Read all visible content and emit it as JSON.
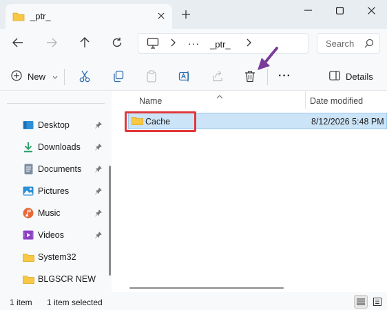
{
  "tab": {
    "title": "_ptr_"
  },
  "address": {
    "ellipsis": "···",
    "crumb": "_ptr_"
  },
  "search": {
    "placeholder": "Search"
  },
  "command_bar": {
    "new_label": "New",
    "more": "···",
    "details_label": "Details"
  },
  "sidebar": {
    "items": [
      {
        "label": "Desktop",
        "icon": "desktop-icon",
        "pinned": true
      },
      {
        "label": "Downloads",
        "icon": "download-icon",
        "pinned": true
      },
      {
        "label": "Documents",
        "icon": "document-icon",
        "pinned": true
      },
      {
        "label": "Pictures",
        "icon": "picture-icon",
        "pinned": true
      },
      {
        "label": "Music",
        "icon": "music-icon",
        "pinned": true
      },
      {
        "label": "Videos",
        "icon": "video-icon",
        "pinned": true
      },
      {
        "label": "System32",
        "icon": "folder-icon",
        "pinned": false
      },
      {
        "label": "BLGSCR NEW",
        "icon": "folder-icon",
        "pinned": false
      }
    ]
  },
  "file_list": {
    "columns": {
      "name": "Name",
      "date": "Date modified"
    },
    "rows": [
      {
        "name": "Cache",
        "date": "8/12/2026 5:48 PM",
        "selected": true
      }
    ]
  },
  "status": {
    "count": "1 item",
    "selection": "1 item selected"
  },
  "colors": {
    "accent": "#0067c0",
    "selection": "#cce4f7",
    "highlight_box": "#e0383a",
    "annotation_arrow": "#7a3c9a",
    "folder": "#f8c844"
  }
}
